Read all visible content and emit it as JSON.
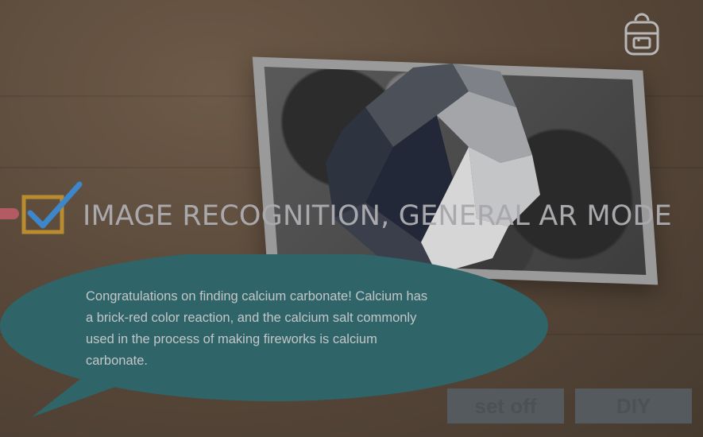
{
  "banner": {
    "title": "IMAGE RECOGNITION, GENERAL AR MODE",
    "checkbox_color": "#b98d2f",
    "check_color": "#3c86c9"
  },
  "dialog": {
    "message": "Congratulations on finding calcium carbonate! Calcium has a brick-red color reaction, and the calcium salt commonly used in the process of making fireworks is calcium carbonate.",
    "bubble_color": "#2f6569"
  },
  "actions": {
    "set_off_label": "set off",
    "diy_label": "DIY"
  },
  "toolbar": {
    "backpack_icon": "backpack-icon"
  }
}
